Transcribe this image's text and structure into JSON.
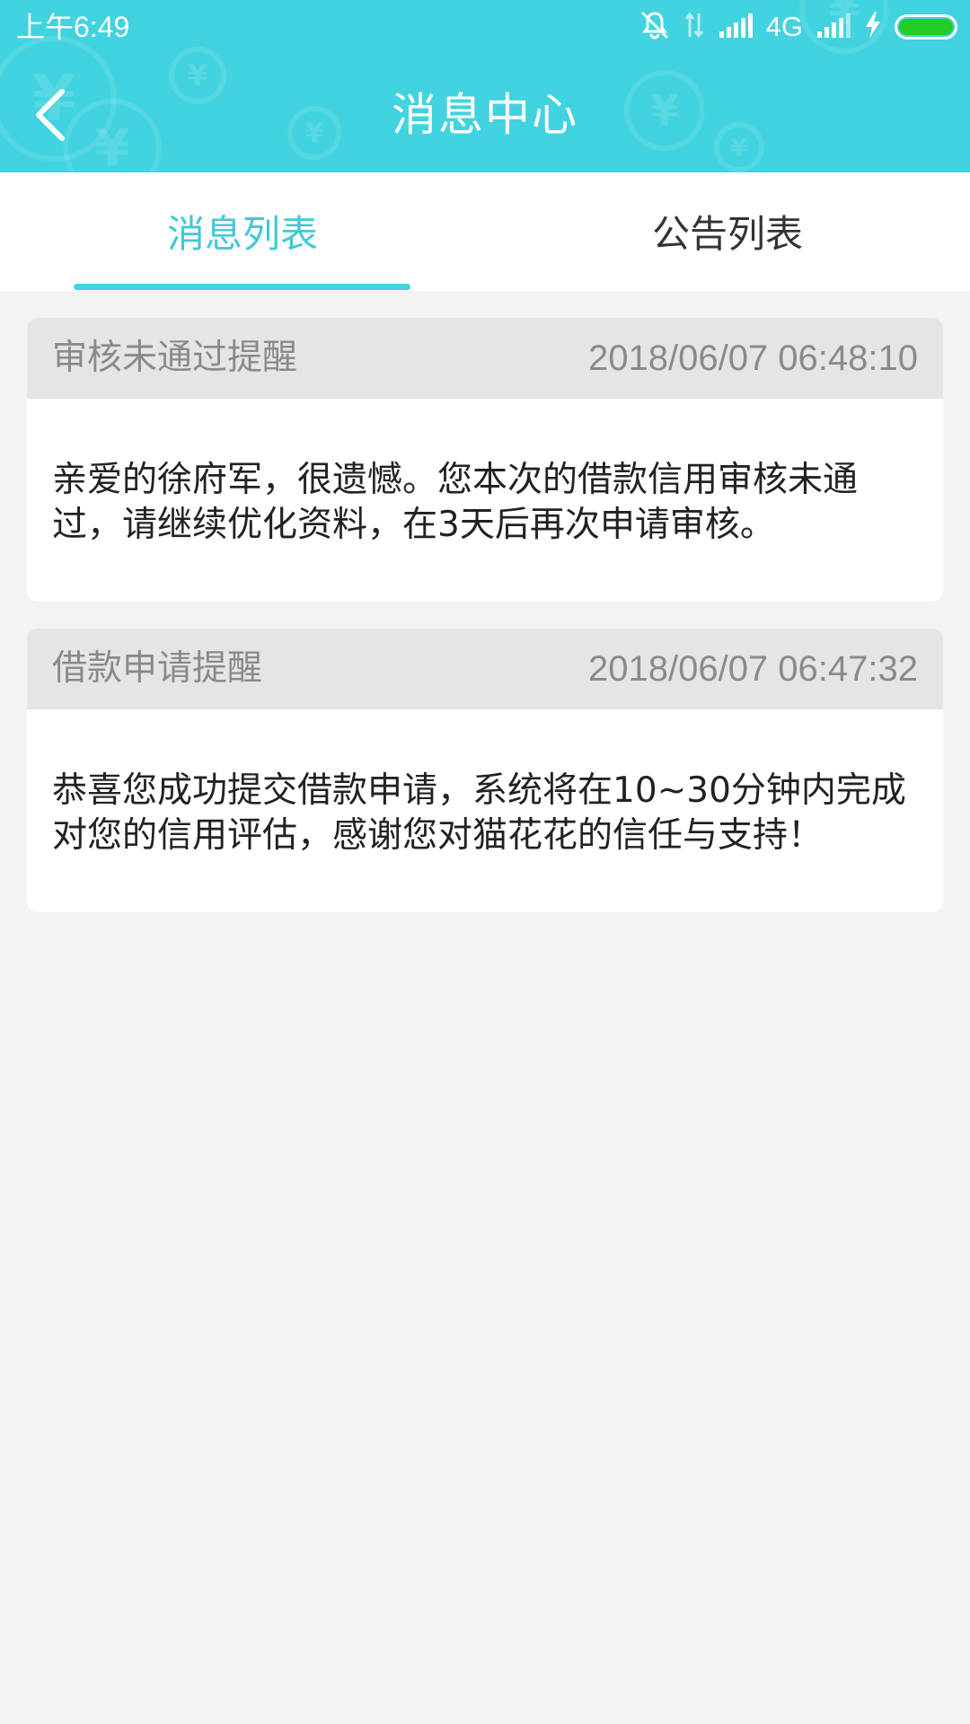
{
  "status_bar": {
    "time": "上午6:49",
    "network": "4G",
    "icons": [
      "mute-icon",
      "data-arrows-icon",
      "signal-icon",
      "signal-icon",
      "charging-icon",
      "battery-icon"
    ],
    "battery_color": "#22cc22"
  },
  "header": {
    "title": "消息中心",
    "background_color": "#41d3df",
    "back_icon": "chevron-left-icon"
  },
  "tabs": [
    {
      "label": "消息列表",
      "active": true
    },
    {
      "label": "公告列表",
      "active": false
    }
  ],
  "accent_color": "#41c8d6",
  "messages": [
    {
      "title": "审核未通过提醒",
      "time": "2018/06/07 06:48:10",
      "body": "亲爱的徐府军，很遗憾。您本次的借款信用审核未通过，请继续优化资料，在3天后再次申请审核。"
    },
    {
      "title": "借款申请提醒",
      "time": "2018/06/07 06:47:32",
      "body": "恭喜您成功提交借款申请，系统将在10~30分钟内完成对您的信用评估，感谢您对猫花花的信任与支持！"
    }
  ]
}
